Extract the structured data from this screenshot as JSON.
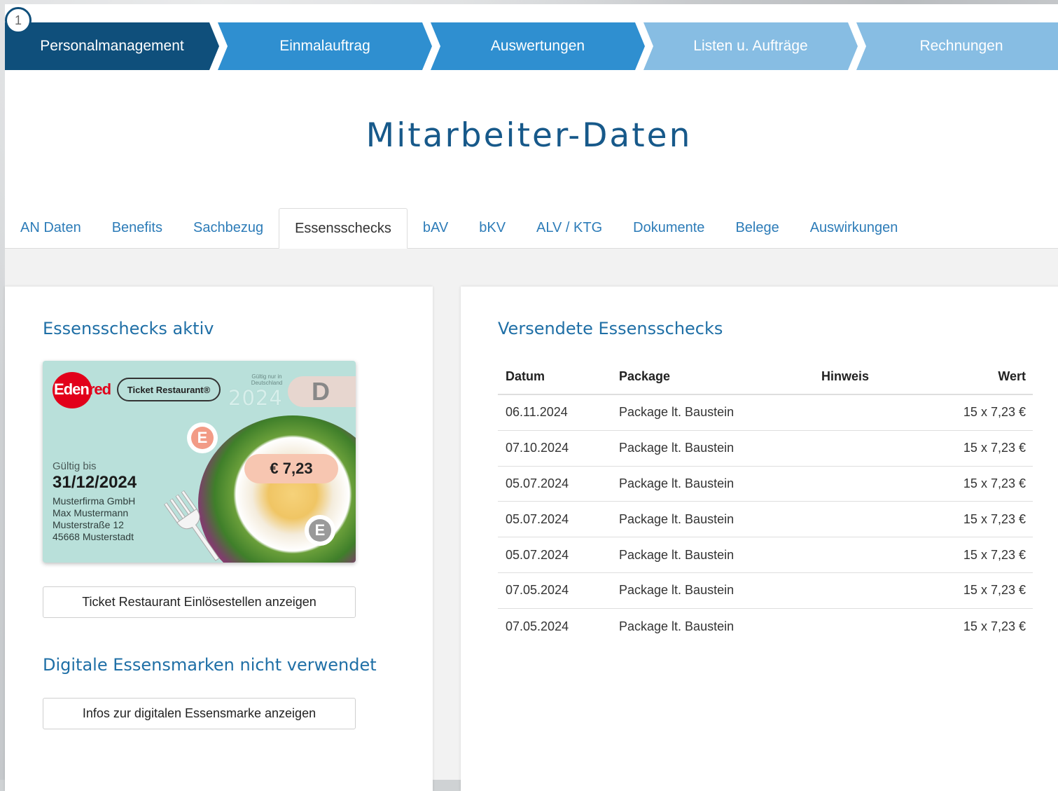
{
  "wizard": {
    "current_step_number": "1",
    "steps": [
      {
        "label": "Personalmanagement",
        "state": "active"
      },
      {
        "label": "Einmalauftrag",
        "state": "available"
      },
      {
        "label": "Auswertungen",
        "state": "available"
      },
      {
        "label": "Listen u. Aufträge",
        "state": "disabled"
      },
      {
        "label": "Rechnungen",
        "state": "disabled"
      }
    ]
  },
  "page_title": "Mitarbeiter-Daten",
  "tabs": [
    {
      "label": "AN Daten"
    },
    {
      "label": "Benefits"
    },
    {
      "label": "Sachbezug"
    },
    {
      "label": "Essensschecks",
      "active": true
    },
    {
      "label": "bAV"
    },
    {
      "label": "bKV"
    },
    {
      "label": "ALV / KTG"
    },
    {
      "label": "Dokumente"
    },
    {
      "label": "Belege"
    },
    {
      "label": "Auswirkungen"
    }
  ],
  "left_panel": {
    "heading": "Essensschecks aktiv",
    "card": {
      "brand": "Edenred",
      "brand_prefix": "E",
      "brand_mid": "den",
      "brand_suffix": "red",
      "product": "Ticket Restaurant®",
      "validity_note": "Gültig nur in Deutschland",
      "year": "2024",
      "country_letter": "D",
      "coin_letter": "E",
      "price": "€ 7,23",
      "valid_label": "Gültig bis",
      "valid_until": "31/12/2024",
      "company": "Musterfirma GmbH",
      "employee": "Max Mustermann",
      "street": "Musterstraße 12",
      "city": "45668 Musterstadt"
    },
    "show_locations_button": "Ticket Restaurant Einlösestellen anzeigen",
    "digital_heading": "Digitale Essensmarken nicht verwendet",
    "digital_info_button": "Infos zur digitalen Essensmarke anzeigen"
  },
  "right_panel": {
    "heading": "Versendete Essensschecks",
    "columns": {
      "date": "Datum",
      "package": "Package",
      "hint": "Hinweis",
      "value": "Wert"
    },
    "rows": [
      {
        "date": "06.11.2024",
        "package": "Package lt. Baustein",
        "hint": "",
        "value": "15 x 7,23 €"
      },
      {
        "date": "07.10.2024",
        "package": "Package lt. Baustein",
        "hint": "",
        "value": "15 x 7,23 €"
      },
      {
        "date": "05.07.2024",
        "package": "Package lt. Baustein",
        "hint": "",
        "value": "15 x 7,23 €"
      },
      {
        "date": "05.07.2024",
        "package": "Package lt. Baustein",
        "hint": "",
        "value": "15 x 7,23 €"
      },
      {
        "date": "05.07.2024",
        "package": "Package lt. Baustein",
        "hint": "",
        "value": "15 x 7,23 €"
      },
      {
        "date": "07.05.2024",
        "package": "Package lt. Baustein",
        "hint": "",
        "value": "15 x 7,23 €"
      },
      {
        "date": "07.05.2024",
        "package": "Package lt. Baustein",
        "hint": "",
        "value": "15 x 7,23 €"
      }
    ]
  },
  "colors": {
    "step_active": "#0f4f7b",
    "step_available": "#2f8fd0",
    "step_disabled": "#87bde3",
    "heading_blue": "#1f6fa6",
    "tab_link": "#2d7cb8"
  }
}
